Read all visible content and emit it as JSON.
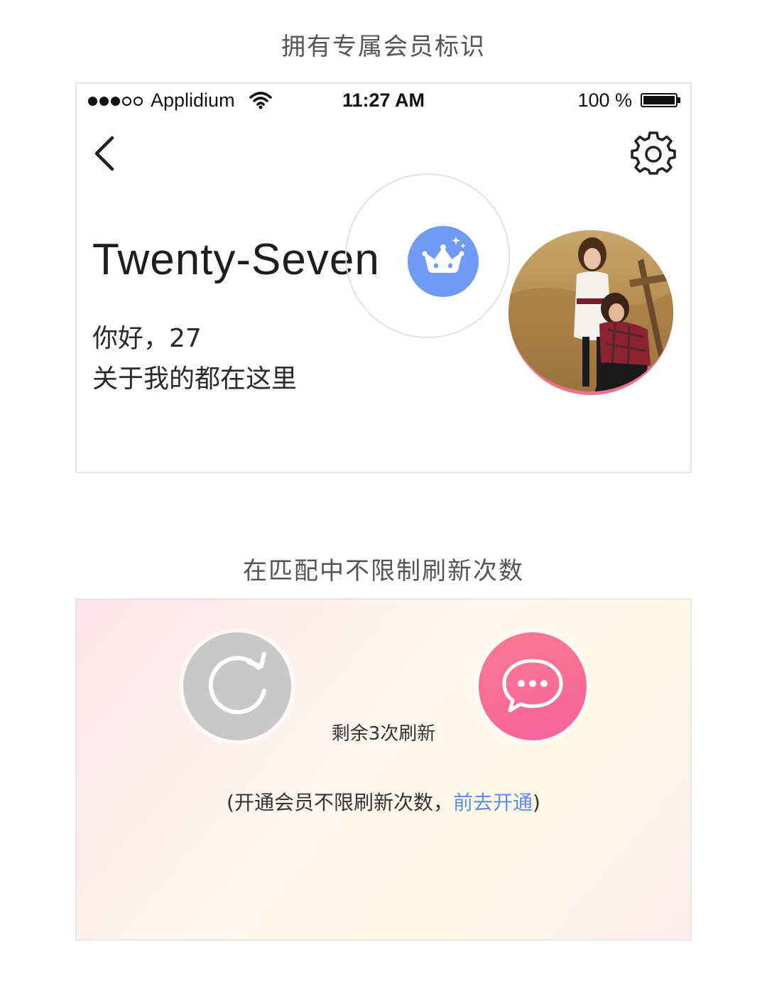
{
  "sections": [
    {
      "caption": "拥有专属会员标识"
    },
    {
      "caption": "在匹配中不限制刷新次数"
    }
  ],
  "status_bar": {
    "carrier": "Applidium",
    "time": "11:27 AM",
    "battery": "100 %",
    "battery_level_percent": 100,
    "signal_bars_filled": 3,
    "signal_bars_total": 5
  },
  "profile": {
    "name": "Twenty-Seven",
    "greeting_line1": "你好，27",
    "greeting_line2": "关于我的都在这里",
    "badge_color": "#6f9bf5",
    "ring_accent": "#ef6e8a",
    "icons": {
      "back": "chevron-left-icon",
      "settings": "gear-icon",
      "badge": "crown-icon"
    }
  },
  "refresh": {
    "remaining_text": "剩余3次刷新",
    "note_prefix": "(开通会员不限刷新次数，",
    "note_link": "前去开通",
    "note_suffix": ")",
    "link_color": "#5b8ee8",
    "icons": {
      "refresh": "refresh-icon",
      "chat": "chat-bubble-icon"
    },
    "colors": {
      "refresh_button": "#c8c8c8",
      "chat_button": "#f76b95"
    }
  }
}
